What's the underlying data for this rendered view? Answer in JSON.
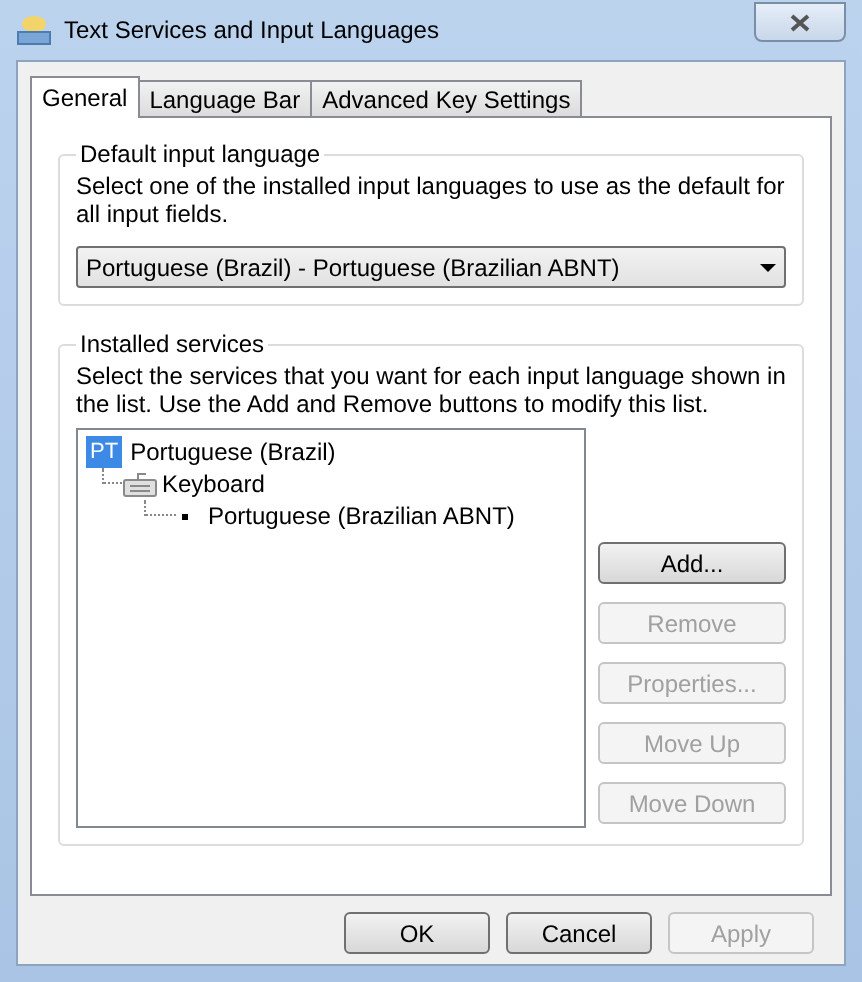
{
  "window": {
    "title": "Text Services and Input Languages"
  },
  "tabs": [
    {
      "label": "General",
      "selected": true
    },
    {
      "label": "Language Bar",
      "selected": false
    },
    {
      "label": "Advanced Key Settings",
      "selected": false
    }
  ],
  "default_input_language": {
    "title": "Default input language",
    "description": "Select one of the installed input languages to use as the default for all input fields.",
    "dropdown": {
      "value": "Portuguese (Brazil) - Portuguese (Brazilian ABNT)"
    }
  },
  "installed_services": {
    "title": "Installed services",
    "description": "Select the services that you want for each input language shown in the list. Use the Add and Remove buttons to modify this list.",
    "tree": [
      {
        "kind": "language",
        "badge": "PT",
        "label": "Portuguese (Brazil)",
        "children": [
          {
            "kind": "category",
            "label": "Keyboard",
            "children": [
              {
                "kind": "service",
                "label": "Portuguese (Brazilian ABNT)"
              }
            ]
          }
        ]
      }
    ],
    "buttons": [
      {
        "label": "Add...",
        "disabled": false
      },
      {
        "label": "Remove",
        "disabled": true
      },
      {
        "label": "Properties...",
        "disabled": true
      },
      {
        "label": "Move Up",
        "disabled": true
      },
      {
        "label": "Move Down",
        "disabled": true
      }
    ]
  },
  "dialog_buttons": [
    {
      "label": "OK",
      "disabled": false
    },
    {
      "label": "Cancel",
      "disabled": false
    },
    {
      "label": "Apply",
      "disabled": true
    }
  ]
}
